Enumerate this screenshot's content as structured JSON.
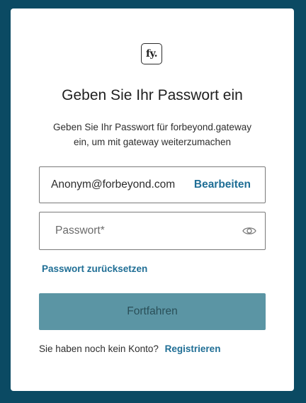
{
  "logo": {
    "text": "fy."
  },
  "title": "Geben Sie Ihr Passwort ein",
  "subtitle": {
    "line1": "Geben Sie Ihr Passwort für forbeyond.gateway",
    "line2": "ein, um mit gateway weiterzumachen"
  },
  "email": {
    "value": "Anonym@forbeyond.com",
    "edit_label": "Bearbeiten"
  },
  "password": {
    "placeholder": "Passwort*",
    "value": "",
    "toggle_icon": "eye-icon"
  },
  "reset_label": "Passwort zurücksetzen",
  "continue_label": "Fortfahren",
  "signup": {
    "prompt": "Sie haben noch kein Konto?",
    "link_label": "Registrieren"
  },
  "colors": {
    "page_background": "#0b4a63",
    "card_background": "#ffffff",
    "link": "#1f6e95",
    "button_background": "#5b95a4",
    "button_text": "#2a4f58"
  }
}
